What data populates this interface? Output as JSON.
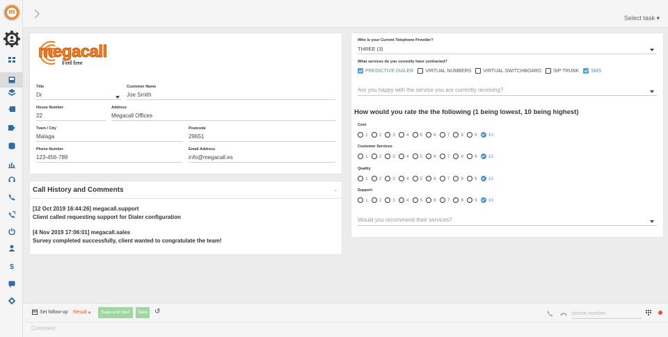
{
  "topbar": {
    "select_task": "Select task"
  },
  "logo": {
    "brand": "megacall",
    "tagline": "Feel free"
  },
  "customer": {
    "title_label": "Title",
    "title_value": "Dr",
    "name_label": "Customer Name",
    "name_value": "Joe Smith",
    "house_label": "House Number",
    "house_value": "22",
    "address_label": "Address",
    "address_value": "Megacall Offices",
    "town_label": "Town / City",
    "town_value": "Malaga",
    "postcode_label": "Postcode",
    "postcode_value": "29651",
    "phone_label": "Phone Number",
    "phone_value": "123-456-789",
    "email_label": "Email Address",
    "email_value": "info@megacall.es"
  },
  "history": {
    "title": "Call History and Comments",
    "entries": [
      {
        "header": "[12 Oct 2019 16:44:26] megacall.support",
        "text": "Client called requesting support for Dialer configuration"
      },
      {
        "header": "[4 Nov 2019 17:06:01] megacall.sales",
        "text": "Survey completed successfully, client wanted to congratulate the team!"
      }
    ]
  },
  "survey": {
    "provider_label": "Who is your Current Telephone Provider?",
    "provider_value": "THREE (3)",
    "services_label": "What services do you currently have contracted?",
    "services": [
      {
        "label": "PREDICTIVE DIALER",
        "checked": true
      },
      {
        "label": "VIRTUAL NUMBERS",
        "checked": false
      },
      {
        "label": "VIRTUAL SWITCHBOARD",
        "checked": false
      },
      {
        "label": "SIP TRUNK",
        "checked": false
      },
      {
        "label": "SMS",
        "checked": true
      }
    ],
    "happy_placeholder": "Are you happy with the service you are currently receiving?",
    "rate_title": "How would you rate the the following (1 being lowest, 10 being highest)",
    "ratings": [
      {
        "label": "Cost",
        "selected": 10
      },
      {
        "label": "Customer Services",
        "selected": 10
      },
      {
        "label": "Quality",
        "selected": 10
      },
      {
        "label": "Support",
        "selected": 10
      }
    ],
    "scale": [
      "1",
      "2",
      "3",
      "4",
      "5",
      "6",
      "7",
      "8",
      "9",
      "10"
    ],
    "recommend_placeholder": "Would you recommend their services?"
  },
  "bottom": {
    "set_followup": "Set follow-up",
    "result": "Result",
    "save_next": "Save and next",
    "save": "Save",
    "comment_placeholder": "Comment",
    "phone_placeholder": "phone number"
  },
  "colors": {
    "accent": "#4a90c8",
    "brand": "#f58220",
    "result": "#e0533d",
    "green_button": "#9fd7a3",
    "record": "#e74c3c"
  }
}
